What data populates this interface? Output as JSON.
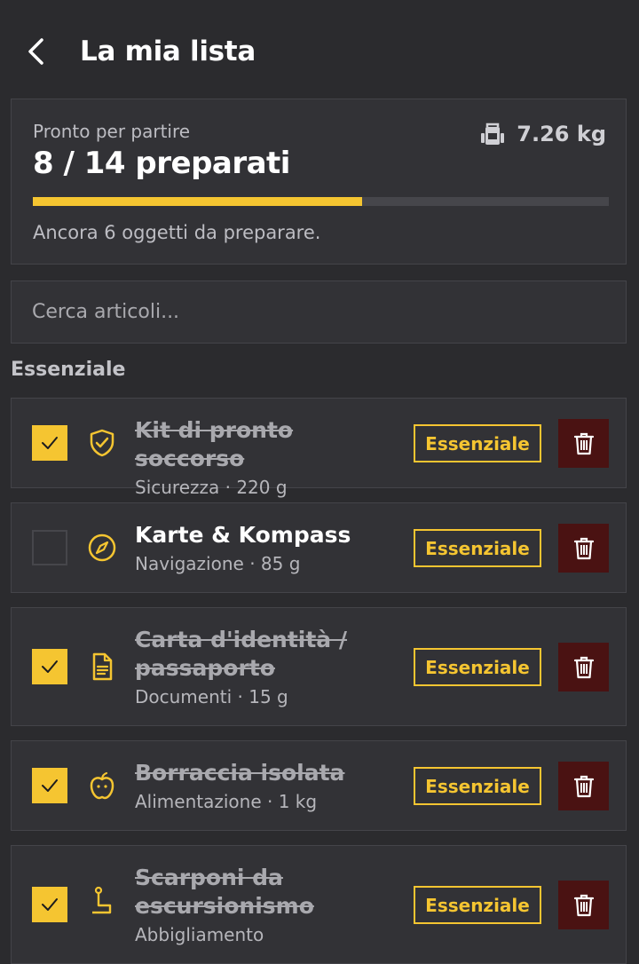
{
  "header": {
    "title": "La mia lista"
  },
  "summary": {
    "subtitle": "Pronto per partire",
    "count": "8 / 14 preparati",
    "weight": "7.26 kg",
    "progress_fraction": 0.5714,
    "remaining": "Ancora 6 oggetti da preparare."
  },
  "search": {
    "placeholder": "Cerca articoli..."
  },
  "section": {
    "title": "Essenziale"
  },
  "items": [
    {
      "name": "Kit di pronto soccorso",
      "meta": "Sicurezza · 220 g",
      "badge": "Essenziale",
      "checked": true,
      "icon": "shield-check-icon"
    },
    {
      "name": "Karte & Kompass",
      "meta": "Navigazione · 85 g",
      "badge": "Essenziale",
      "checked": false,
      "icon": "compass-icon"
    },
    {
      "name": "Carta d'identità / passaporto",
      "meta": "Documenti · 15 g",
      "badge": "Essenziale",
      "checked": true,
      "icon": "document-icon"
    },
    {
      "name": "Borraccia isolata",
      "meta": "Alimentazione · 1 kg",
      "badge": "Essenziale",
      "checked": true,
      "icon": "apple-icon"
    },
    {
      "name": "Scarponi da escursionismo",
      "meta": "Abbigliamento",
      "badge": "Essenziale",
      "checked": true,
      "icon": "boot-icon"
    }
  ],
  "colors": {
    "accent": "#f5c531",
    "background": "#2b2b2e",
    "card": "#323236",
    "delete": "#4a1212"
  }
}
